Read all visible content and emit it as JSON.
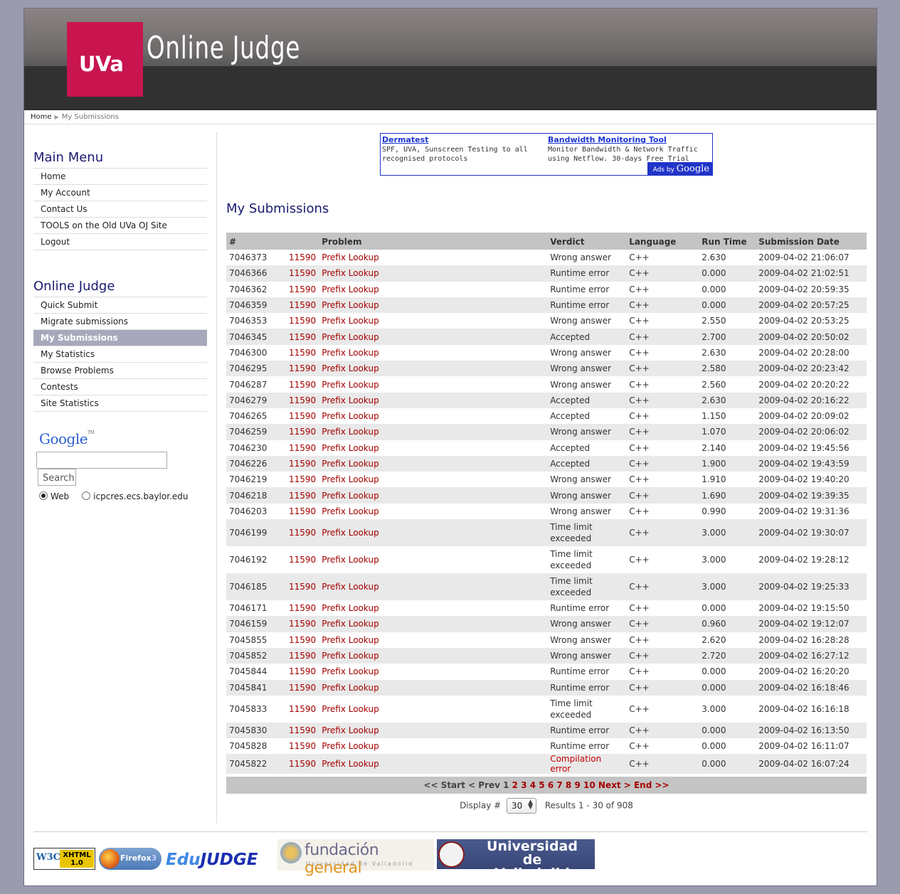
{
  "header": {
    "logo_text": "UVa",
    "site_title": "Online Judge"
  },
  "breadcrumb": {
    "home": "Home",
    "current": "My Submissions"
  },
  "sidebar": {
    "main_menu_title": "Main Menu",
    "main_menu": [
      {
        "label": "Home"
      },
      {
        "label": "My Account"
      },
      {
        "label": "Contact Us"
      },
      {
        "label": "TOOLS on the Old UVa OJ Site"
      },
      {
        "label": "Logout"
      }
    ],
    "judge_menu_title": "Online Judge",
    "judge_menu": [
      {
        "label": "Quick Submit"
      },
      {
        "label": "Migrate submissions"
      },
      {
        "label": "My Submissions",
        "active": true
      },
      {
        "label": "My Statistics"
      },
      {
        "label": "Browse Problems"
      },
      {
        "label": "Contests"
      },
      {
        "label": "Site Statistics"
      }
    ]
  },
  "google_search": {
    "logo": "Google",
    "tm": "TM",
    "button": "Search",
    "input_value": "",
    "radio_web": "Web",
    "radio_site": "icpcres.ecs.baylor.edu",
    "selected": "Web"
  },
  "ad": {
    "items": [
      {
        "title": "Dermatest",
        "text": "SPF, UVA, Sunscreen Testing to all recognised protocols"
      },
      {
        "title": "Bandwidth Monitoring Tool",
        "text": "Monitor Bandwidth & Network Traffic using Netflow. 30-days Free Trial"
      }
    ],
    "badge_prefix": "Ads by",
    "badge_brand": "Google"
  },
  "main": {
    "title": "My Submissions",
    "columns": [
      "#",
      "Problem",
      "Verdict",
      "Language",
      "Run Time",
      "Submission Date"
    ],
    "rows": [
      {
        "id": "7046373",
        "pid": "11590",
        "ptitle": "Prefix Lookup",
        "verdict": "Wrong answer",
        "lang": "C++",
        "time": "2.630",
        "date": "2009-04-02 21:06:07"
      },
      {
        "id": "7046366",
        "pid": "11590",
        "ptitle": "Prefix Lookup",
        "verdict": "Runtime error",
        "lang": "C++",
        "time": "0.000",
        "date": "2009-04-02 21:02:51"
      },
      {
        "id": "7046362",
        "pid": "11590",
        "ptitle": "Prefix Lookup",
        "verdict": "Runtime error",
        "lang": "C++",
        "time": "0.000",
        "date": "2009-04-02 20:59:35"
      },
      {
        "id": "7046359",
        "pid": "11590",
        "ptitle": "Prefix Lookup",
        "verdict": "Runtime error",
        "lang": "C++",
        "time": "0.000",
        "date": "2009-04-02 20:57:25"
      },
      {
        "id": "7046353",
        "pid": "11590",
        "ptitle": "Prefix Lookup",
        "verdict": "Wrong answer",
        "lang": "C++",
        "time": "2.550",
        "date": "2009-04-02 20:53:25"
      },
      {
        "id": "7046345",
        "pid": "11590",
        "ptitle": "Prefix Lookup",
        "verdict": "Accepted",
        "lang": "C++",
        "time": "2.700",
        "date": "2009-04-02 20:50:02"
      },
      {
        "id": "7046300",
        "pid": "11590",
        "ptitle": "Prefix Lookup",
        "verdict": "Wrong answer",
        "lang": "C++",
        "time": "2.630",
        "date": "2009-04-02 20:28:00"
      },
      {
        "id": "7046295",
        "pid": "11590",
        "ptitle": "Prefix Lookup",
        "verdict": "Wrong answer",
        "lang": "C++",
        "time": "2.580",
        "date": "2009-04-02 20:23:42"
      },
      {
        "id": "7046287",
        "pid": "11590",
        "ptitle": "Prefix Lookup",
        "verdict": "Wrong answer",
        "lang": "C++",
        "time": "2.560",
        "date": "2009-04-02 20:20:22"
      },
      {
        "id": "7046279",
        "pid": "11590",
        "ptitle": "Prefix Lookup",
        "verdict": "Accepted",
        "lang": "C++",
        "time": "2.630",
        "date": "2009-04-02 20:16:22"
      },
      {
        "id": "7046265",
        "pid": "11590",
        "ptitle": "Prefix Lookup",
        "verdict": "Accepted",
        "lang": "C++",
        "time": "1.150",
        "date": "2009-04-02 20:09:02"
      },
      {
        "id": "7046259",
        "pid": "11590",
        "ptitle": "Prefix Lookup",
        "verdict": "Wrong answer",
        "lang": "C++",
        "time": "1.070",
        "date": "2009-04-02 20:06:02"
      },
      {
        "id": "7046230",
        "pid": "11590",
        "ptitle": "Prefix Lookup",
        "verdict": "Accepted",
        "lang": "C++",
        "time": "2.140",
        "date": "2009-04-02 19:45:56"
      },
      {
        "id": "7046226",
        "pid": "11590",
        "ptitle": "Prefix Lookup",
        "verdict": "Accepted",
        "lang": "C++",
        "time": "1.900",
        "date": "2009-04-02 19:43:59"
      },
      {
        "id": "7046219",
        "pid": "11590",
        "ptitle": "Prefix Lookup",
        "verdict": "Wrong answer",
        "lang": "C++",
        "time": "1.910",
        "date": "2009-04-02 19:40:20"
      },
      {
        "id": "7046218",
        "pid": "11590",
        "ptitle": "Prefix Lookup",
        "verdict": "Wrong answer",
        "lang": "C++",
        "time": "1.690",
        "date": "2009-04-02 19:39:35"
      },
      {
        "id": "7046203",
        "pid": "11590",
        "ptitle": "Prefix Lookup",
        "verdict": "Wrong answer",
        "lang": "C++",
        "time": "0.990",
        "date": "2009-04-02 19:31:36"
      },
      {
        "id": "7046199",
        "pid": "11590",
        "ptitle": "Prefix Lookup",
        "verdict": "Time limit exceeded",
        "lang": "C++",
        "time": "3.000",
        "date": "2009-04-02 19:30:07"
      },
      {
        "id": "7046192",
        "pid": "11590",
        "ptitle": "Prefix Lookup",
        "verdict": "Time limit exceeded",
        "lang": "C++",
        "time": "3.000",
        "date": "2009-04-02 19:28:12"
      },
      {
        "id": "7046185",
        "pid": "11590",
        "ptitle": "Prefix Lookup",
        "verdict": "Time limit exceeded",
        "lang": "C++",
        "time": "3.000",
        "date": "2009-04-02 19:25:33"
      },
      {
        "id": "7046171",
        "pid": "11590",
        "ptitle": "Prefix Lookup",
        "verdict": "Runtime error",
        "lang": "C++",
        "time": "0.000",
        "date": "2009-04-02 19:15:50"
      },
      {
        "id": "7046159",
        "pid": "11590",
        "ptitle": "Prefix Lookup",
        "verdict": "Wrong answer",
        "lang": "C++",
        "time": "0.960",
        "date": "2009-04-02 19:12:07"
      },
      {
        "id": "7045855",
        "pid": "11590",
        "ptitle": "Prefix Lookup",
        "verdict": "Wrong answer",
        "lang": "C++",
        "time": "2.620",
        "date": "2009-04-02 16:28:28"
      },
      {
        "id": "7045852",
        "pid": "11590",
        "ptitle": "Prefix Lookup",
        "verdict": "Wrong answer",
        "lang": "C++",
        "time": "2.720",
        "date": "2009-04-02 16:27:12"
      },
      {
        "id": "7045844",
        "pid": "11590",
        "ptitle": "Prefix Lookup",
        "verdict": "Runtime error",
        "lang": "C++",
        "time": "0.000",
        "date": "2009-04-02 16:20:20"
      },
      {
        "id": "7045841",
        "pid": "11590",
        "ptitle": "Prefix Lookup",
        "verdict": "Runtime error",
        "lang": "C++",
        "time": "0.000",
        "date": "2009-04-02 16:18:46"
      },
      {
        "id": "7045833",
        "pid": "11590",
        "ptitle": "Prefix Lookup",
        "verdict": "Time limit exceeded",
        "lang": "C++",
        "time": "3.000",
        "date": "2009-04-02 16:16:18"
      },
      {
        "id": "7045830",
        "pid": "11590",
        "ptitle": "Prefix Lookup",
        "verdict": "Runtime error",
        "lang": "C++",
        "time": "0.000",
        "date": "2009-04-02 16:13:50"
      },
      {
        "id": "7045828",
        "pid": "11590",
        "ptitle": "Prefix Lookup",
        "verdict": "Runtime error",
        "lang": "C++",
        "time": "0.000",
        "date": "2009-04-02 16:11:07"
      },
      {
        "id": "7045822",
        "pid": "11590",
        "ptitle": "Prefix Lookup",
        "verdict": "Compilation error",
        "lang": "C++",
        "time": "0.000",
        "date": "2009-04-02 16:07:24"
      }
    ]
  },
  "pager": {
    "start": "<< Start",
    "prev": "< Prev",
    "current": "1",
    "pages": [
      "2",
      "3",
      "4",
      "5",
      "6",
      "7",
      "8",
      "9",
      "10"
    ],
    "next": "Next >",
    "end": "End >>"
  },
  "display": {
    "label": "Display #",
    "value": "30",
    "results": "Results 1 - 30 of 908"
  },
  "footer": {
    "w3c": "W3C",
    "xhtml": "XHTML 1.0",
    "firefox": "Firefox",
    "firefox_ver": "3",
    "edu": "Edu",
    "judge": "JUDGE",
    "fundacion_a": "fundación",
    "fundacion_b": "general",
    "fundacion_sub": "Universidad de Valladolid",
    "uva_line1": "Universidad de",
    "uva_line2": "Valladolid"
  },
  "colors": {
    "accent": "#c8154f",
    "link_red": "#a40000",
    "heading_blue": "#1a1a70",
    "menu_active": "#a8a8bc",
    "page_bg": "#9b9bb0"
  }
}
